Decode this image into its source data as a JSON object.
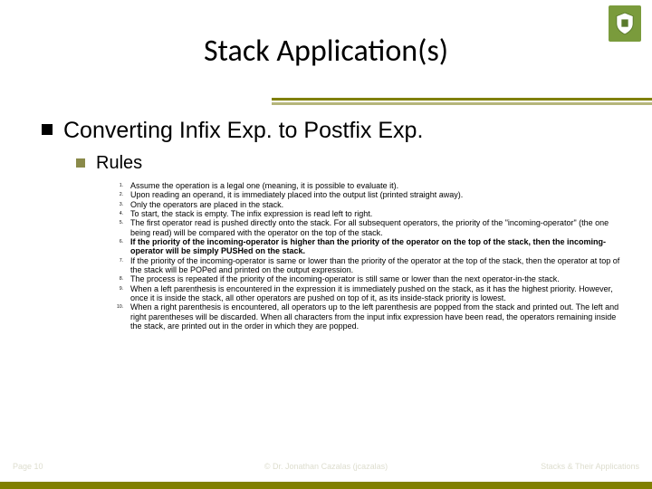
{
  "title": "Stack Application(s)",
  "heading": "Converting Infix Exp. to Postfix Exp.",
  "subheading": "Rules",
  "rules": [
    {
      "n": "1.",
      "t": "Assume the operation is a legal one (meaning, it is possible to evaluate it).",
      "b": false
    },
    {
      "n": "2.",
      "t": "Upon reading an operand, it is immediately placed into the output list (printed straight away).",
      "b": false
    },
    {
      "n": "3.",
      "t": "Only the operators are placed in the stack.",
      "b": false
    },
    {
      "n": "4.",
      "t": "To start, the stack is empty. The infix expression is read left to right.",
      "b": false
    },
    {
      "n": "5.",
      "t": "The first operator read is pushed directly onto the stack. For all subsequent operators, the priority of the \"incoming-operator\" (the one being read) will be compared with the operator on the top of the stack.",
      "b": false
    },
    {
      "n": "6.",
      "t": "If the priority of the incoming-operator is higher than the priority of the operator on the top of the stack, then the incoming-operator will be simply PUSHed on the stack.",
      "b": true
    },
    {
      "n": "7.",
      "t": "If the priority of the incoming-operator is same or lower than the priority of the operator at the top of the stack, then the operator at top of the stack will be POPed and printed on the output expression.",
      "b": false
    },
    {
      "n": "8.",
      "t": "The process is repeated if the priority of the incoming-operator is still same or lower than the next operator-in-the stack.",
      "b": false
    },
    {
      "n": "9.",
      "t": "When a left parenthesis is encountered in the expression it is immediately pushed on the stack, as it has the highest priority. However, once it is inside the stack, all other operators are pushed on top of it, as its inside-stack priority is lowest.",
      "b": false
    },
    {
      "n": "10.",
      "t": "When a right parenthesis is encountered, all operators up to the left parenthesis are popped from the stack and printed out. The left and right parentheses will be discarded. When all characters from the input infix expression have been read, the operators remaining inside the stack, are printed out in the order in which they are popped.",
      "b": false
    }
  ],
  "footer": {
    "left": "Page 10",
    "center": "© Dr. Jonathan Cazalas (jcazalas)",
    "right": "Stacks & Their Applications"
  }
}
